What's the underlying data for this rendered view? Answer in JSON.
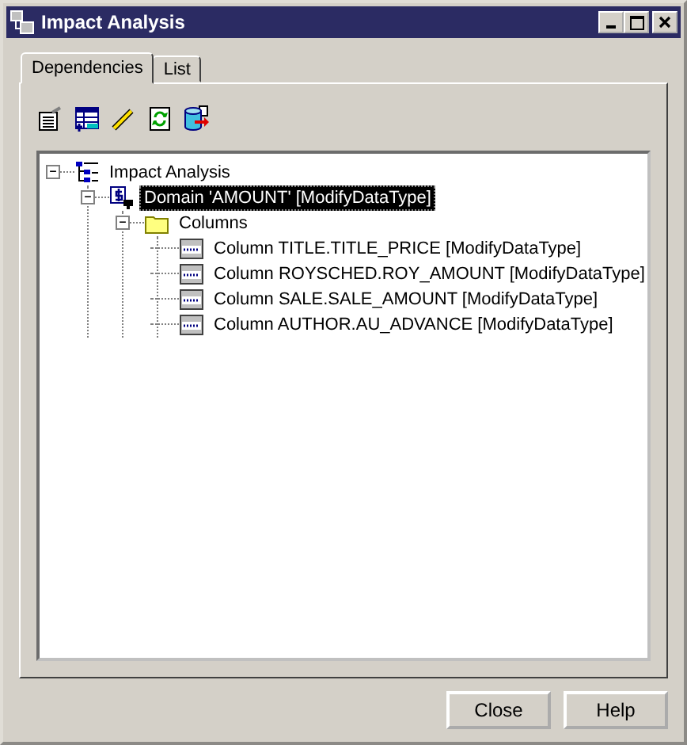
{
  "window": {
    "title": "Impact Analysis"
  },
  "tabs": [
    {
      "label": "Dependencies",
      "selected": true
    },
    {
      "label": "List",
      "selected": false
    }
  ],
  "tree": [
    {
      "kind": "root",
      "label": "Impact Analysis",
      "expanded": true,
      "selected": false,
      "children": [
        {
          "kind": "domain",
          "label": "Domain 'AMOUNT' [ModifyDataType]",
          "expanded": true,
          "selected": true,
          "children": [
            {
              "kind": "folder",
              "label": "Columns",
              "expanded": true,
              "selected": false,
              "children": [
                {
                  "kind": "column",
                  "label": "Column TITLE.TITLE_PRICE [ModifyDataType]",
                  "selected": false
                },
                {
                  "kind": "column",
                  "label": "Column ROYSCHED.ROY_AMOUNT [ModifyDataType]",
                  "selected": false
                },
                {
                  "kind": "column",
                  "label": "Column SALE.SALE_AMOUNT [ModifyDataType]",
                  "selected": false
                },
                {
                  "kind": "column",
                  "label": "Column AUTHOR.AU_ADVANCE [ModifyDataType]",
                  "selected": false
                }
              ]
            }
          ]
        }
      ]
    }
  ],
  "buttons": [
    "Close",
    "Help"
  ]
}
